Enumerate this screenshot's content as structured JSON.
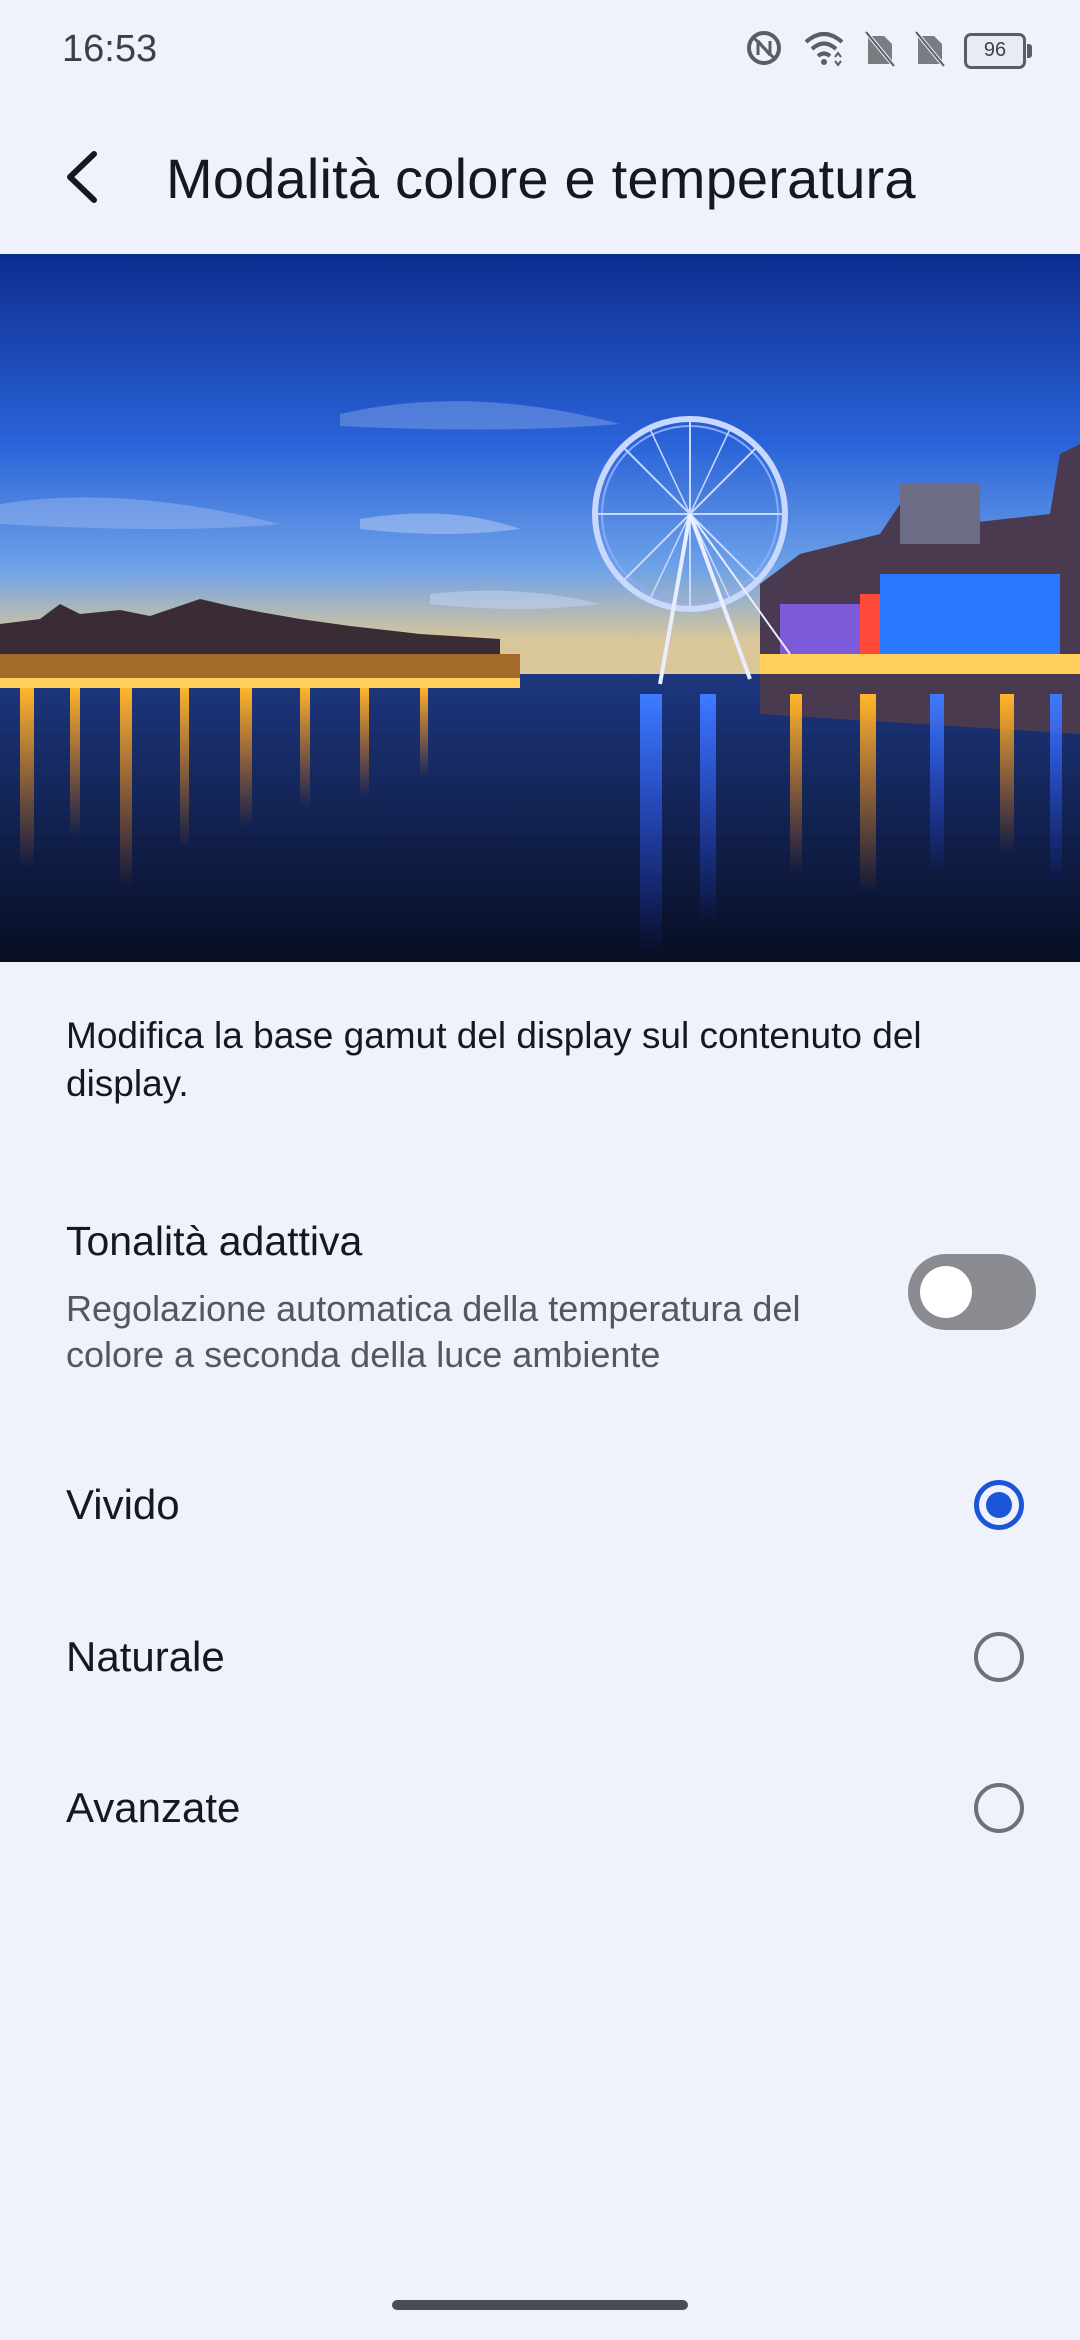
{
  "status_bar": {
    "time": "16:53",
    "battery": "96",
    "icons": [
      "nfc-icon",
      "wifi-icon",
      "no-sim-icon",
      "no-sim-icon",
      "battery-icon"
    ]
  },
  "header": {
    "back_icon": "back-arrow-icon",
    "title": "Modalità colore e temperatura"
  },
  "hero": {
    "image": "london-eye-thames-night-photo"
  },
  "description": "Modifica la base gamut del display sul contenuto del display.",
  "adaptive_tone": {
    "title": "Tonalità adattiva",
    "subtitle": "Regolazione automatica della temperatura del colore a seconda della luce ambiente",
    "enabled": false
  },
  "color_modes": [
    {
      "label": "Vivido",
      "selected": true
    },
    {
      "label": "Naturale",
      "selected": false
    },
    {
      "label": "Avanzate",
      "selected": false
    }
  ],
  "colors": {
    "background": "#eff1fb",
    "accent": "#1a56d6",
    "toggle_off": "#8a8c92"
  }
}
